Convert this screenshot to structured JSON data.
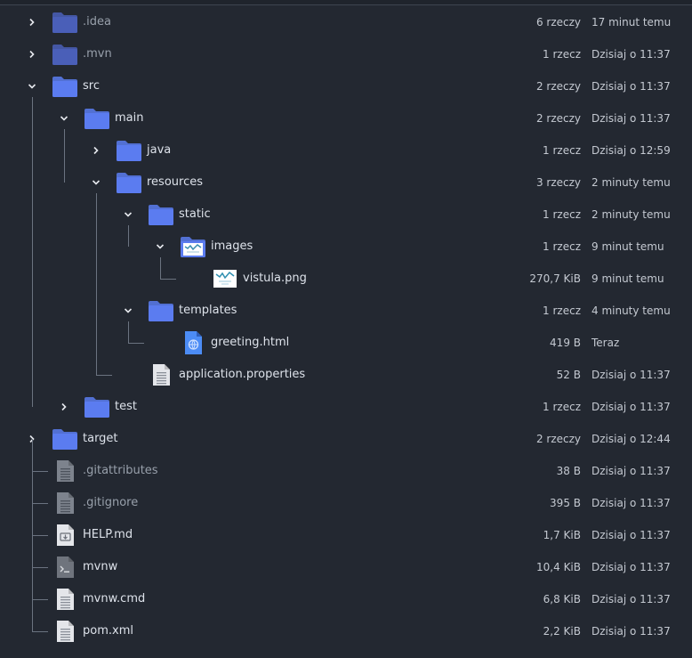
{
  "colors": {
    "background": "#232831",
    "folder": "#5b7cf0",
    "folder_dim": "#4a5fb8",
    "text": "#dde2ea",
    "text_dim": "#98a0ab",
    "meta_text": "#c4c9d1",
    "tree_line": "#6b7380"
  },
  "rows": [
    {
      "name": ".idea",
      "size": "6 rzeczy",
      "date": "17 minut temu",
      "depth": 0,
      "kind": "folder",
      "expander": "collapsed",
      "dim": true,
      "icon": "folder-icon"
    },
    {
      "name": ".mvn",
      "size": "1 rzecz",
      "date": "Dzisiaj o 11:37",
      "depth": 0,
      "kind": "folder",
      "expander": "collapsed",
      "dim": true,
      "icon": "folder-icon"
    },
    {
      "name": "src",
      "size": "2 rzeczy",
      "date": "Dzisiaj o 11:37",
      "depth": 0,
      "kind": "folder",
      "expander": "expanded",
      "dim": false,
      "icon": "folder-icon"
    },
    {
      "name": "main",
      "size": "2 rzeczy",
      "date": "Dzisiaj o 11:37",
      "depth": 1,
      "kind": "folder",
      "expander": "expanded",
      "dim": false,
      "icon": "folder-icon"
    },
    {
      "name": "java",
      "size": "1 rzecz",
      "date": "Dzisiaj o 12:59",
      "depth": 2,
      "kind": "folder",
      "expander": "collapsed",
      "dim": false,
      "icon": "folder-icon"
    },
    {
      "name": "resources",
      "size": "3 rzeczy",
      "date": "2 minuty temu",
      "depth": 2,
      "kind": "folder",
      "expander": "expanded",
      "dim": false,
      "icon": "folder-icon"
    },
    {
      "name": "static",
      "size": "1 rzecz",
      "date": "2 minuty temu",
      "depth": 3,
      "kind": "folder",
      "expander": "expanded",
      "dim": false,
      "icon": "folder-icon"
    },
    {
      "name": "images",
      "size": "1 rzecz",
      "date": "9 minut temu",
      "depth": 4,
      "kind": "folder-image",
      "expander": "expanded",
      "dim": false,
      "icon": "image-folder-icon"
    },
    {
      "name": "vistula.png",
      "size": "270,7 KiB",
      "date": "9 minut temu",
      "depth": 5,
      "kind": "image",
      "expander": "none",
      "dim": false,
      "icon": "image-thumbnail-icon"
    },
    {
      "name": "templates",
      "size": "1 rzecz",
      "date": "4 minuty temu",
      "depth": 3,
      "kind": "folder",
      "expander": "expanded",
      "dim": false,
      "icon": "folder-icon"
    },
    {
      "name": "greeting.html",
      "size": "419 B",
      "date": "Teraz",
      "depth": 4,
      "kind": "html",
      "expander": "none",
      "dim": false,
      "icon": "html-file-icon"
    },
    {
      "name": "application.properties",
      "size": "52 B",
      "date": "Dzisiaj o 11:37",
      "depth": 3,
      "kind": "text",
      "expander": "none",
      "dim": false,
      "icon": "text-file-icon"
    },
    {
      "name": "test",
      "size": "1 rzecz",
      "date": "Dzisiaj o 11:37",
      "depth": 1,
      "kind": "folder",
      "expander": "collapsed",
      "dim": false,
      "icon": "folder-icon"
    },
    {
      "name": "target",
      "size": "2 rzeczy",
      "date": "Dzisiaj o 12:44",
      "depth": 0,
      "kind": "folder",
      "expander": "collapsed",
      "dim": false,
      "icon": "folder-icon"
    },
    {
      "name": ".gitattributes",
      "size": "38 B",
      "date": "Dzisiaj o 11:37",
      "depth": 0,
      "kind": "text-dim",
      "expander": "none",
      "dim": true,
      "icon": "text-file-icon"
    },
    {
      "name": ".gitignore",
      "size": "395 B",
      "date": "Dzisiaj o 11:37",
      "depth": 0,
      "kind": "text-dim",
      "expander": "none",
      "dim": true,
      "icon": "text-file-icon"
    },
    {
      "name": "HELP.md",
      "size": "1,7 KiB",
      "date": "Dzisiaj o 11:37",
      "depth": 0,
      "kind": "markdown",
      "expander": "none",
      "dim": false,
      "icon": "markdown-file-icon"
    },
    {
      "name": "mvnw",
      "size": "10,4 KiB",
      "date": "Dzisiaj o 11:37",
      "depth": 0,
      "kind": "script",
      "expander": "none",
      "dim": false,
      "icon": "script-file-icon"
    },
    {
      "name": "mvnw.cmd",
      "size": "6,8 KiB",
      "date": "Dzisiaj o 11:37",
      "depth": 0,
      "kind": "text",
      "expander": "none",
      "dim": false,
      "icon": "text-file-icon"
    },
    {
      "name": "pom.xml",
      "size": "2,2 KiB",
      "date": "Dzisiaj o 11:37",
      "depth": 0,
      "kind": "text",
      "expander": "none",
      "dim": false,
      "icon": "text-file-icon"
    }
  ]
}
